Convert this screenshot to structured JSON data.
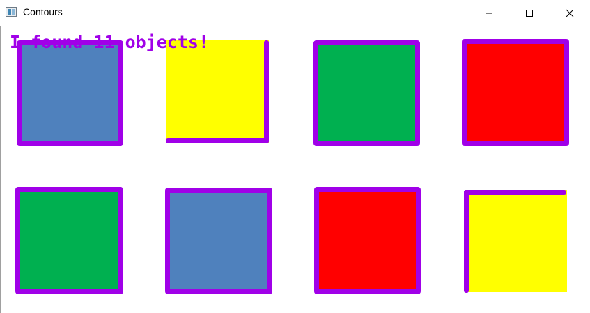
{
  "window": {
    "title": "Contours",
    "app_icon": "window-app-icon",
    "controls": {
      "minimize_icon": "minimize-icon",
      "maximize_icon": "maximize-icon",
      "close_icon": "close-icon"
    }
  },
  "overlay_text": "I found 11 objects!",
  "colors": {
    "contour": "#a000e8",
    "blue": "#4f81bd",
    "yellow": "#ffff00",
    "green": "#00b050",
    "red": "#ff0000"
  },
  "shapes": {
    "row1": [
      "blue",
      "yellow",
      "green",
      "red"
    ],
    "row2": [
      "green",
      "blue",
      "red",
      "yellow"
    ]
  }
}
